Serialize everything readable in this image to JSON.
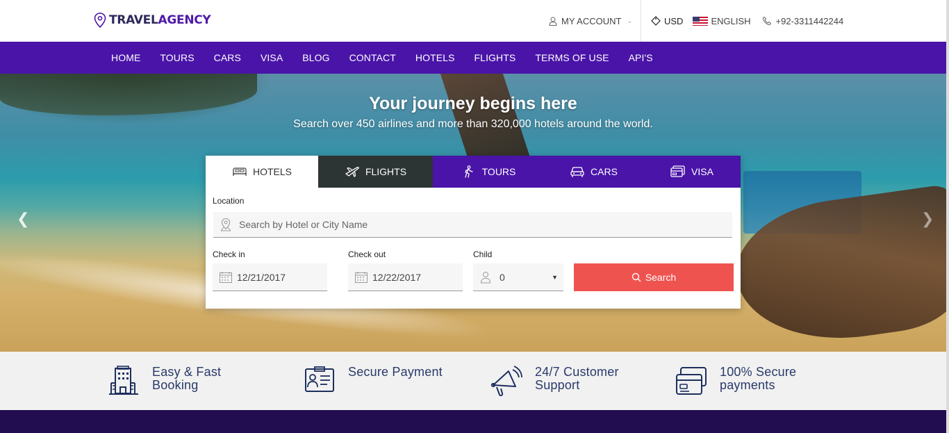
{
  "brand": {
    "logo_part1": "TRAVEL",
    "logo_part2": "AGENCY",
    "color_primary": "#4a14a8",
    "color_dark": "#2d2a5a"
  },
  "topbar": {
    "account_label": "MY ACCOUNT",
    "currency": "USD",
    "language": "ENGLISH",
    "phone": "+92-3311442244"
  },
  "nav": {
    "items": [
      "HOME",
      "TOURS",
      "CARS",
      "VISA",
      "BLOG",
      "CONTACT",
      "HOTELS",
      "FLIGHTS",
      "TERMS OF USE",
      "API'S"
    ]
  },
  "hero": {
    "title": "Your journey begins here",
    "subtitle": "Search over 450 airlines and more than 320,000 hotels around the world."
  },
  "search": {
    "tabs": [
      {
        "label": "HOTELS",
        "icon": "bed-icon"
      },
      {
        "label": "FLIGHTS",
        "icon": "plane-icon"
      },
      {
        "label": "TOURS",
        "icon": "hiker-icon"
      },
      {
        "label": "CARS",
        "icon": "car-icon"
      },
      {
        "label": "VISA",
        "icon": "card-icon"
      }
    ],
    "location_label": "Location",
    "location_placeholder": "Search by Hotel or City Name",
    "checkin_label": "Check in",
    "checkin_value": "12/21/2017",
    "checkout_label": "Check out",
    "checkout_value": "12/22/2017",
    "child_label": "Child",
    "child_value": "0",
    "search_button": "Search",
    "button_color": "#ef5350"
  },
  "features": [
    {
      "line1": "Easy & Fast",
      "line2": "Booking",
      "icon": "hotel-building-icon"
    },
    {
      "line1": "Secure Payment",
      "line2": "",
      "icon": "id-card-icon"
    },
    {
      "line1": "24/7 Customer",
      "line2": "Support",
      "icon": "megaphone-icon"
    },
    {
      "line1": "100% Secure",
      "line2": "payments",
      "icon": "credit-card-icon"
    }
  ]
}
